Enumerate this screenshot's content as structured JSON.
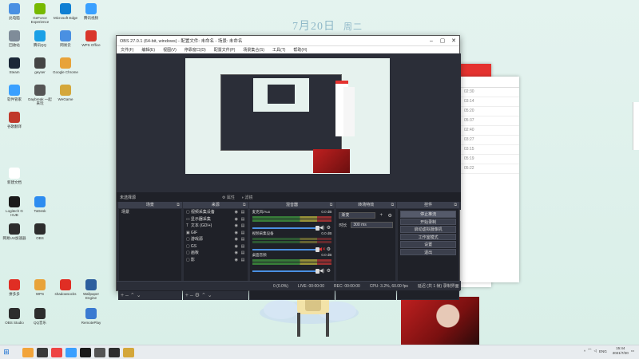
{
  "desktop": {
    "date": "7月20日",
    "weekday": "周二",
    "icons": [
      {
        "label": "此电脑",
        "color": "#4a90e2"
      },
      {
        "label": "GeForce Experience",
        "color": "#76b900"
      },
      {
        "label": "Microsoft Edge",
        "color": "#0f7fd3"
      },
      {
        "label": "腾讯视频",
        "color": "#3aa0ff"
      },
      {
        "label": "回收站",
        "color": "#7f8c99"
      },
      {
        "label": "腾讯QQ",
        "color": "#1aa0e6"
      },
      {
        "label": "网易云",
        "color": "#4a90e2"
      },
      {
        "label": "WPS Office",
        "color": "#d9362b"
      },
      {
        "label": "Steam",
        "color": "#1b2838"
      },
      {
        "label": "geyser",
        "color": "#444"
      },
      {
        "label": "Google Chrome",
        "color": "#e8a33a"
      },
      {
        "label": "软件管家",
        "color": "#3aa0ff"
      },
      {
        "label": "Daybreak 一起来玩",
        "color": "#555"
      },
      {
        "label": "WeGame",
        "color": "#d4a73a"
      },
      {
        "label": "谷歌翻译",
        "color": "#c0392b"
      },
      {
        "label": "新建文档",
        "color": "#fff"
      },
      {
        "label": "Logitech G HUB",
        "color": "#1a1a1a"
      },
      {
        "label": "ToDesk",
        "color": "#2d8cf0"
      },
      {
        "label": "网易UU加速器",
        "color": "#2d2d2d"
      },
      {
        "label": "OBS",
        "color": "#2d2d2d"
      },
      {
        "label": "拼多多",
        "color": "#e02e24"
      },
      {
        "label": "WPS",
        "color": "#e8a33a"
      },
      {
        "label": "Wallpaper Engine",
        "color": "#2d5f9e"
      },
      {
        "label": "shadowsocks",
        "color": "#e02e24"
      },
      {
        "label": "OBS Studio",
        "color": "#2d2d2d"
      },
      {
        "label": "QQ音乐",
        "color": "#2d2d2d"
      },
      {
        "label": "RemotePlay",
        "color": "#3a7ad1"
      }
    ]
  },
  "obs": {
    "title": "OBS 27.0.1 (64-bit, windows) - 配置文件: 未命名 - 场景: 未命名",
    "menu": [
      "文件(F)",
      "编辑(E)",
      "视图(V)",
      "停靠窗口(D)",
      "配置文件(P)",
      "场景集合(S)",
      "工具(T)",
      "帮助(H)"
    ],
    "context_bar": {
      "label": "未选择源",
      "props": "属性",
      "filters": "滤镜"
    },
    "docks": {
      "scenes": {
        "title": "场景",
        "items": [
          "场景"
        ]
      },
      "sources": {
        "title": "来源",
        "items": [
          {
            "icon": "▢",
            "label": "视频采集设备"
          },
          {
            "icon": "▭",
            "label": "显示器采集"
          },
          {
            "icon": "T",
            "label": "文本 (GDI+)"
          },
          {
            "icon": "▣",
            "label": "GIF"
          },
          {
            "icon": "▢",
            "label": "游戏源"
          },
          {
            "icon": "▢",
            "label": "GS"
          },
          {
            "icon": "▢",
            "label": "画板"
          },
          {
            "icon": "▢",
            "label": "影"
          }
        ]
      },
      "mixer": {
        "title": "混音器",
        "channels": [
          {
            "name": "麦克风/Aux",
            "db": "0.0 dB",
            "muted": false
          },
          {
            "name": "视频采集设备",
            "db": "0.0 dB",
            "muted": true
          },
          {
            "name": "桌面音频",
            "db": "0.0 dB",
            "muted": false
          }
        ]
      },
      "transitions": {
        "title": "转场特效",
        "type": "渐变",
        "duration_label": "时长",
        "duration": "300 ms"
      },
      "controls": {
        "title": "控件",
        "buttons": [
          "停止推流",
          "开始录制",
          "启动虚拟摄像机",
          "工作室模式",
          "设置",
          "退出"
        ]
      }
    },
    "status": {
      "dropped": "0 (0.0%)",
      "live": "LIVE: 00:00:00",
      "rec": "REC: 00:00:00",
      "cpu": "CPU: 3.2%, 60.00 fps",
      "extra": "延迟 (共 1 帧) 录制界面"
    }
  },
  "bgwindow": {
    "rows": [
      "02:30",
      "03:14",
      "05:20",
      "05:37",
      "02:40",
      "03:27",
      "03:15",
      "05:19",
      "05:22"
    ],
    "side_labels": [
      "记得",
      "47",
      "40",
      "50"
    ]
  },
  "taskbar": {
    "start_icon": "windows-icon",
    "apps": [
      "#f2a43a",
      "#3a3a3a",
      "#e44",
      "#3aa0ff",
      "#1a1a1a",
      "#555",
      "#2d2d2d",
      "#d4a73a"
    ],
    "lang": "ENG",
    "time": "15:44",
    "date": "2021/7/20"
  }
}
